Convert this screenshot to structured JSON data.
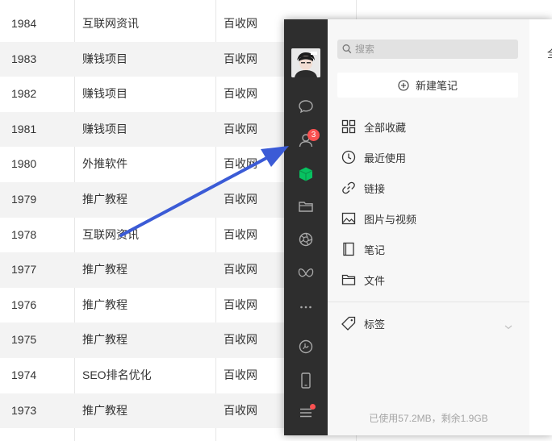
{
  "table": {
    "rows": [
      {
        "id": "1984",
        "category": "互联网资讯",
        "site": "百收网"
      },
      {
        "id": "1983",
        "category": "赚钱项目",
        "site": "百收网"
      },
      {
        "id": "1982",
        "category": "赚钱项目",
        "site": "百收网"
      },
      {
        "id": "1981",
        "category": "赚钱项目",
        "site": "百收网"
      },
      {
        "id": "1980",
        "category": "外推软件",
        "site": "百收网"
      },
      {
        "id": "1979",
        "category": "推广教程",
        "site": "百收网"
      },
      {
        "id": "1978",
        "category": "互联网资讯",
        "site": "百收网"
      },
      {
        "id": "1977",
        "category": "推广教程",
        "site": "百收网"
      },
      {
        "id": "1976",
        "category": "推广教程",
        "site": "百收网"
      },
      {
        "id": "1975",
        "category": "推广教程",
        "site": "百收网"
      },
      {
        "id": "1974",
        "category": "SEO排名优化",
        "site": "百收网"
      },
      {
        "id": "1973",
        "category": "推广教程",
        "site": "百收网"
      }
    ]
  },
  "sidebar": {
    "badge_count": "3",
    "icons": [
      "chat-icon",
      "contacts-icon",
      "favorites-icon",
      "folder-icon",
      "moments-icon",
      "mini-program-icon",
      "more-icon",
      "channels-icon",
      "phone-icon",
      "menu-icon"
    ]
  },
  "favorites": {
    "search_placeholder": "搜索",
    "new_note_label": "新建笔记",
    "items": [
      {
        "label": "全部收藏",
        "icon": "grid-icon"
      },
      {
        "label": "最近使用",
        "icon": "clock-icon"
      },
      {
        "label": "链接",
        "icon": "link-icon"
      },
      {
        "label": "图片与视频",
        "icon": "image-icon"
      },
      {
        "label": "笔记",
        "icon": "note-icon"
      },
      {
        "label": "文件",
        "icon": "folder-icon"
      }
    ],
    "tags_label": "标签",
    "storage_text": "已使用57.2MB，剩余1.9GB"
  },
  "content": {
    "heading_char": "全"
  },
  "colors": {
    "sidebar_bg": "#2e2e2e",
    "badge": "#fa5151",
    "favorites_green": "#07c160",
    "arrow": "#3b5bd6"
  }
}
